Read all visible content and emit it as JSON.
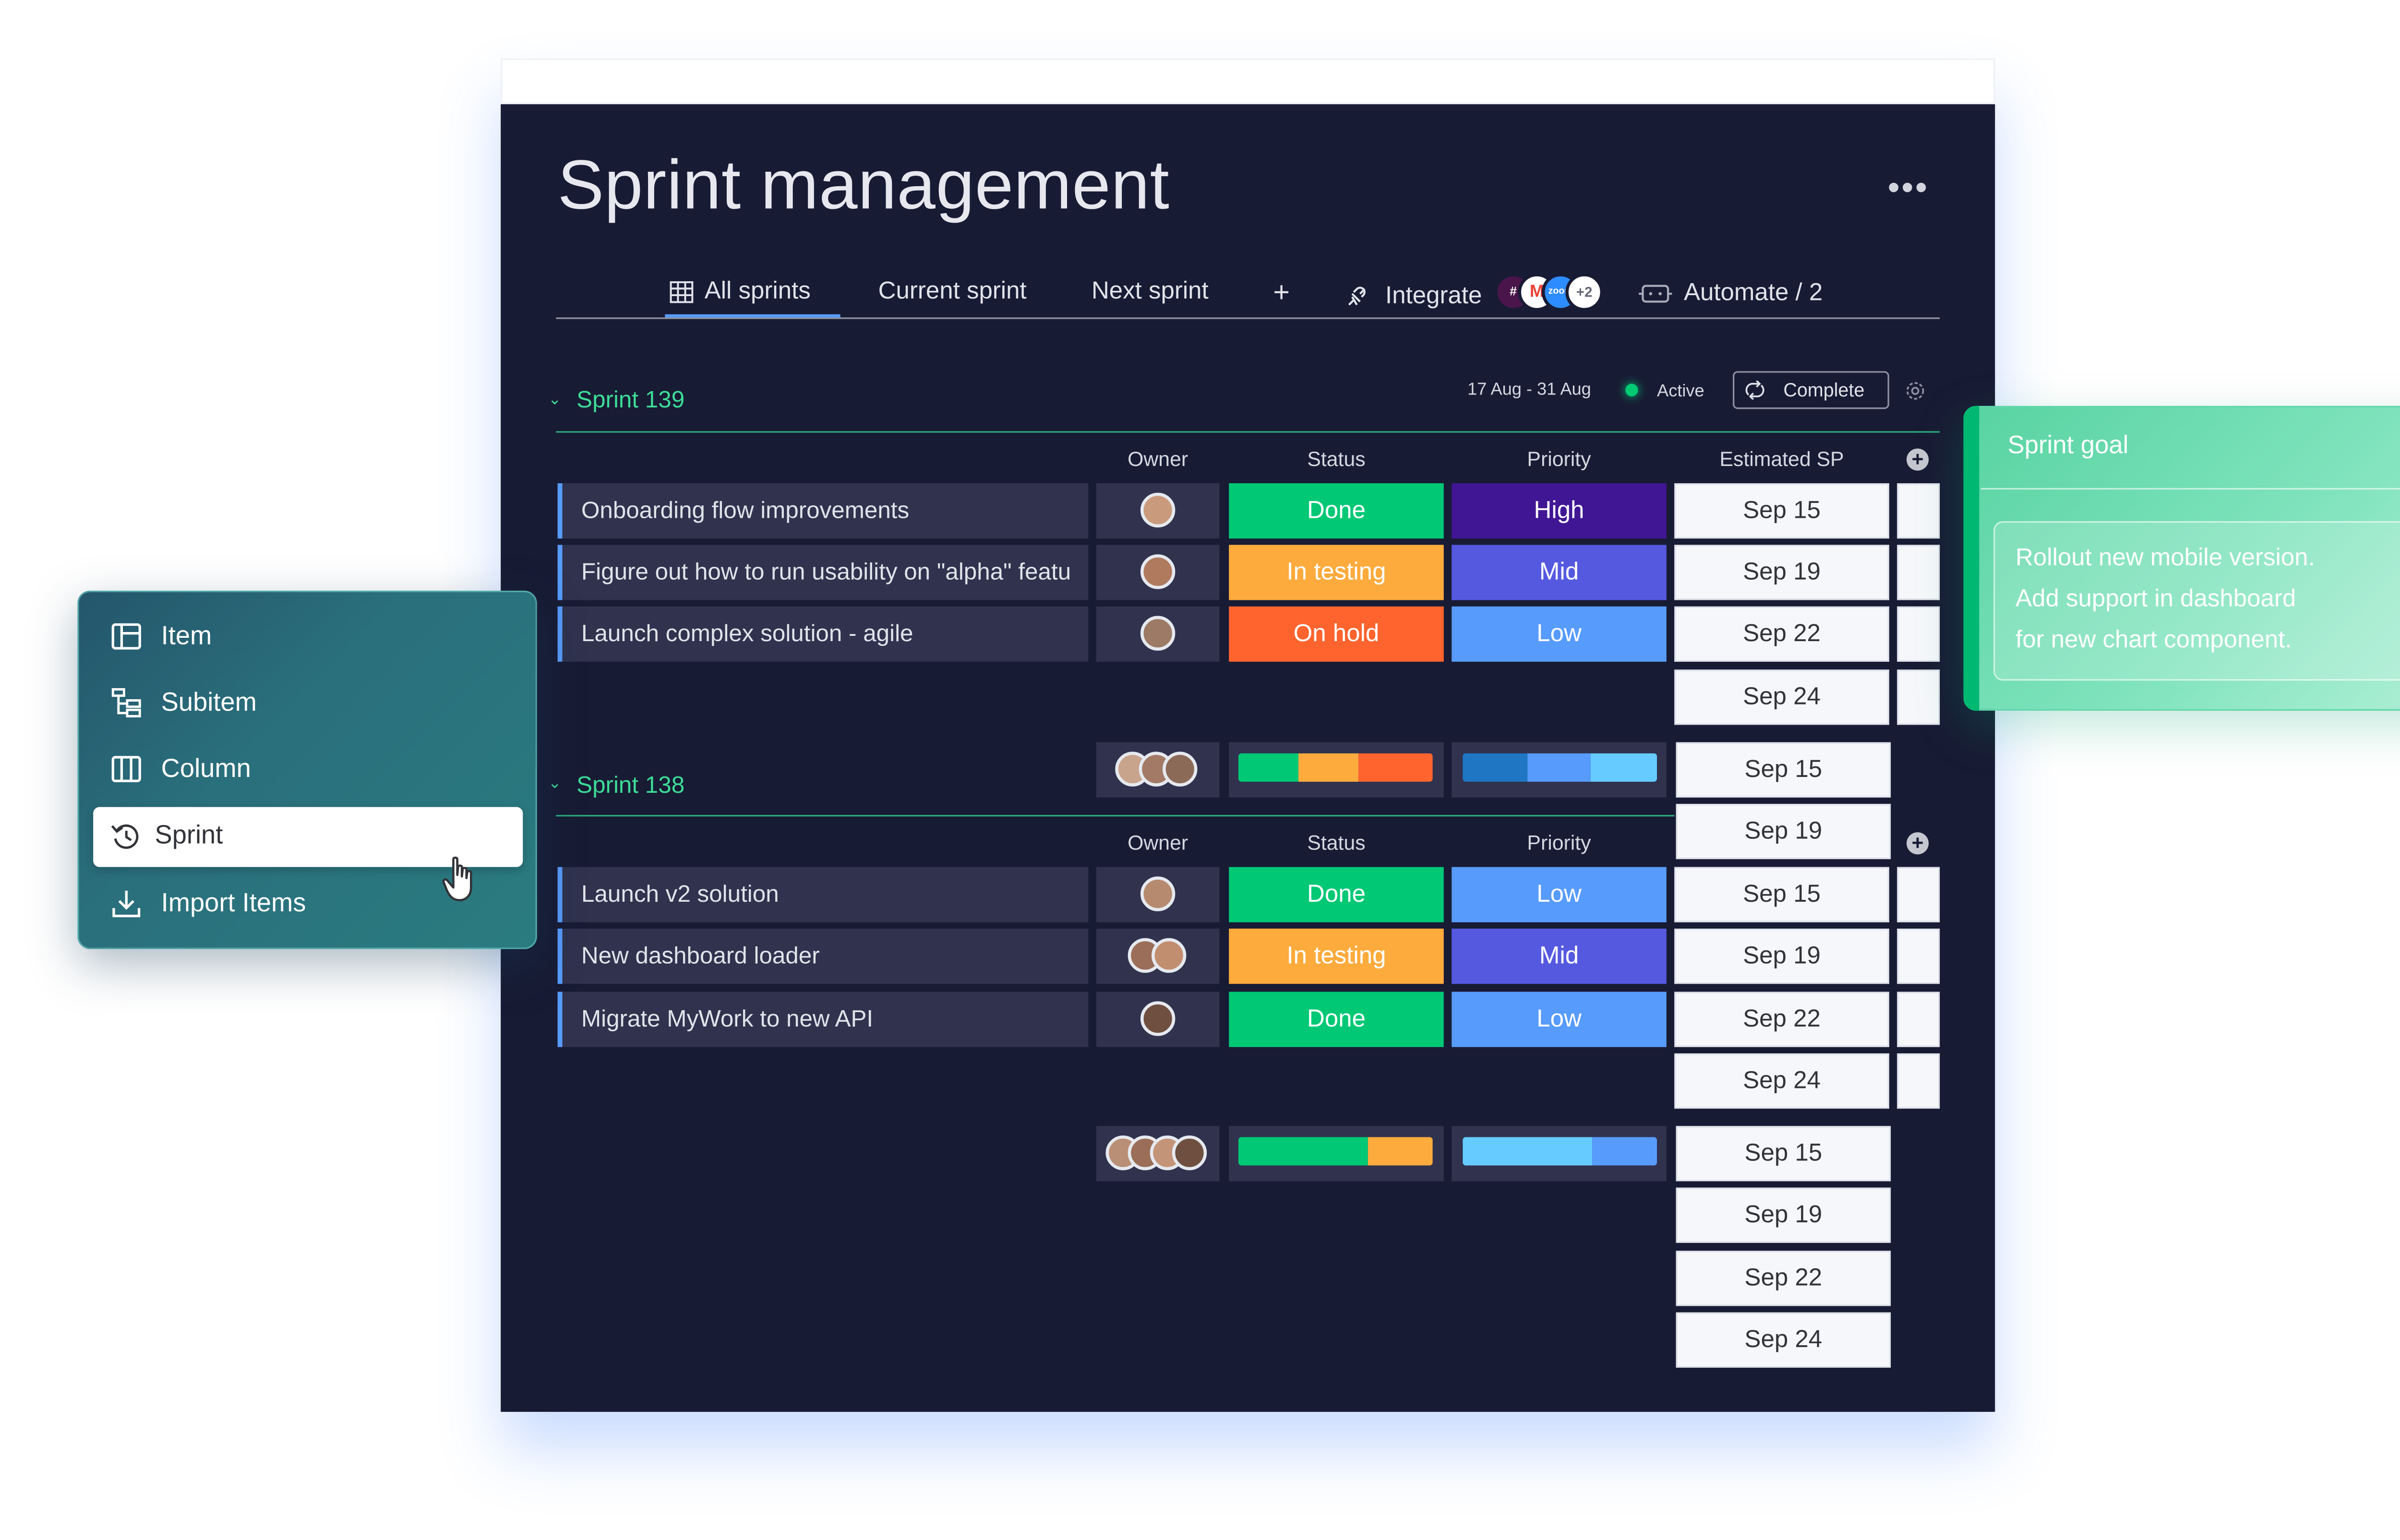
{
  "board": {
    "title": "Sprint management",
    "more_label": "•••",
    "tabs": [
      "All sprints",
      "Current sprint",
      "Next sprint"
    ],
    "add_tab": "+",
    "integrate_label": "Integrate",
    "integrate_extra": "+2",
    "automate_label": "Automate / 2"
  },
  "columns": {
    "owner": "Owner",
    "status": "Status",
    "priority": "Priority",
    "sp": "Estimated SP"
  },
  "sprint139": {
    "name": "Sprint 139",
    "dates": "17 Aug - 31 Aug",
    "state": "Active",
    "complete_label": "Complete",
    "items": [
      {
        "name": "Onboarding flow improvements",
        "status": "Done",
        "priority": "High",
        "sp": "Sep 15"
      },
      {
        "name": "Figure out how to run usability on \"alpha\" featu",
        "status": "In testing",
        "priority": "Mid",
        "sp": "Sep 19"
      },
      {
        "name": "Launch complex solution - agile",
        "status": "On hold",
        "priority": "Low",
        "sp": "Sep 22"
      }
    ],
    "extra_sp": "Sep 24",
    "status_summary": [
      0.31,
      0.31,
      0.38
    ],
    "priority_summary": [
      0.33,
      0.33,
      0.34
    ],
    "summary_sp": [
      "Sep 15",
      "Sep 19"
    ]
  },
  "sprint138": {
    "name": "Sprint 138",
    "items": [
      {
        "name": "Launch v2 solution",
        "status": "Done",
        "priority": "Low",
        "sp": "Sep 15"
      },
      {
        "name": "New dashboard loader",
        "status": "In testing",
        "priority": "Mid",
        "sp": "Sep 19"
      },
      {
        "name": "Migrate MyWork to new API",
        "status": "Done",
        "priority": "Low",
        "sp": "Sep 22"
      }
    ],
    "extra_sp": "Sep 24",
    "status_summary": [
      0.67,
      0.33
    ],
    "priority_summary": [
      0.67,
      0.33
    ],
    "summary_sp": [
      "Sep 15",
      "Sep 19",
      "Sep 22",
      "Sep 24"
    ]
  },
  "colors": {
    "done": "#00c875",
    "in_testing": "#fdab3d",
    "on_hold": "#ff642e",
    "high": "#401694",
    "mid": "#5559df",
    "low": "#579bfc",
    "accent_green": "#3ddc97"
  },
  "add_menu": {
    "items": [
      "Item",
      "Subitem",
      "Column",
      "Sprint",
      "Import Items"
    ]
  },
  "sprint_goal": {
    "title": "Sprint goal",
    "lines": [
      "Rollout new mobile version.",
      "Add support in dashboard",
      "for new chart component."
    ]
  }
}
